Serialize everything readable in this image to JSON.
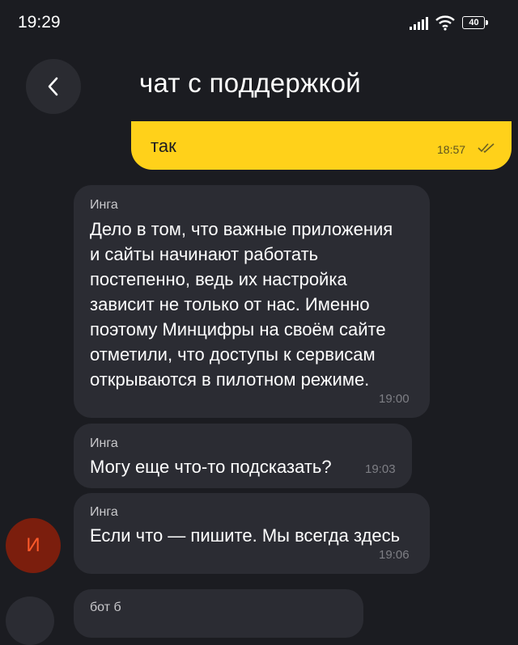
{
  "status_bar": {
    "time": "19:29",
    "battery": "40"
  },
  "header": {
    "title": "чат с поддержкой"
  },
  "messages": [
    {
      "direction": "out",
      "text": "так",
      "time": "18:57"
    },
    {
      "direction": "in",
      "sender": "Инга",
      "text": "Дело в том, что важные приложения\nи сайты начинают работать\nпостепенно, ведь их настройка\nзависит не только от нас. Именно\nпоэтому Минцифры на своём сайте\nотметили, что доступы к сервисам\nоткрываются в пилотном режиме.",
      "time": "19:00"
    },
    {
      "direction": "in",
      "sender": "Инга",
      "text": "Могу еще что-то подсказать?",
      "time": "19:03"
    },
    {
      "direction": "in",
      "sender": "Инга",
      "text": "Если что — пишите. Мы всегда здесь",
      "time": "19:06"
    },
    {
      "direction": "in",
      "sender": "бот б",
      "text": "",
      "time": ""
    }
  ],
  "avatar": {
    "letter": "И"
  },
  "colors": {
    "background": "#1b1c21",
    "bubble_in": "#2b2c33",
    "bubble_out": "#ffd11a",
    "avatar_bg": "#7b1e0d",
    "avatar_letter": "#ff5a2a"
  }
}
